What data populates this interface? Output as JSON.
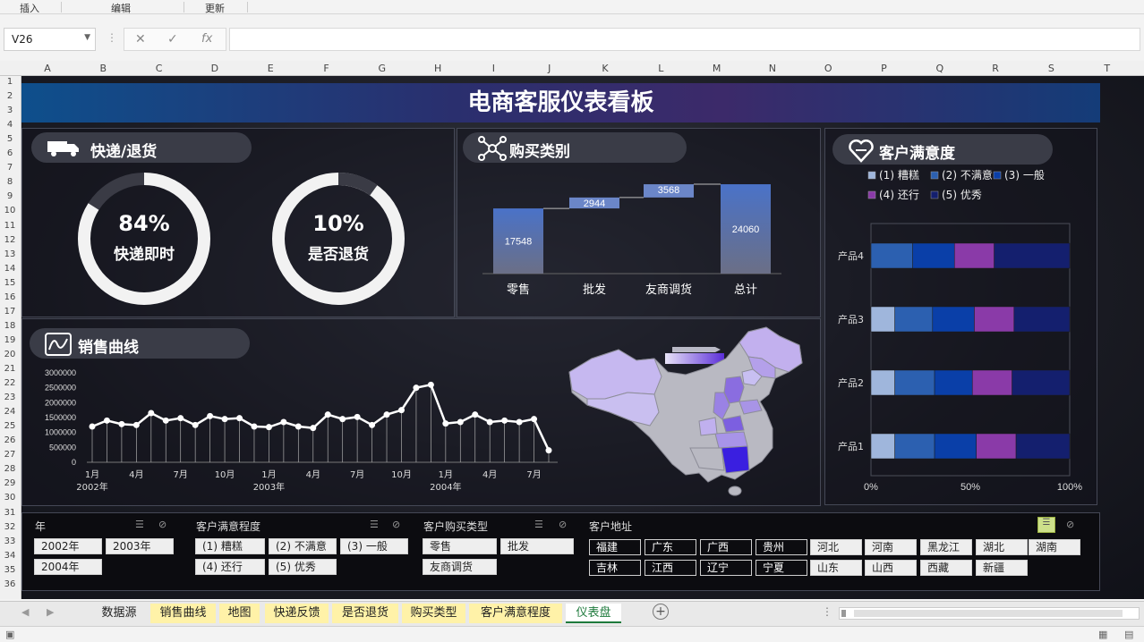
{
  "ribbon": {
    "insert": "插入",
    "edit": "编辑",
    "update": "更新"
  },
  "formula_bar": {
    "cell_ref": "V26",
    "cancel": "✕",
    "confirm": "✓",
    "fx": "fx",
    "value": ""
  },
  "columns": [
    "A",
    "B",
    "C",
    "D",
    "E",
    "F",
    "G",
    "H",
    "I",
    "J",
    "K",
    "L",
    "M",
    "N",
    "O",
    "P",
    "Q",
    "R",
    "S",
    "T"
  ],
  "rows": [
    "1",
    "2",
    "3",
    "4",
    "5",
    "6",
    "7",
    "8",
    "9",
    "10",
    "11",
    "12",
    "13",
    "14",
    "15",
    "16",
    "17",
    "18",
    "19",
    "20",
    "21",
    "22",
    "23",
    "24",
    "25",
    "26",
    "27",
    "28",
    "29",
    "30",
    "31",
    "32",
    "33",
    "34",
    "35",
    "36"
  ],
  "dashboard": {
    "title": "电商客服仪表看板",
    "express": {
      "title": "快递/退货",
      "ring1": {
        "value": "84%",
        "label": "快递即时",
        "fraction": 0.84
      },
      "ring2": {
        "value": "10%",
        "label": "是否退货",
        "fraction": 0.1
      }
    },
    "purchase": {
      "title": "购买类别"
    },
    "satisfaction": {
      "title": "客户满意度"
    },
    "sales": {
      "title": "销售曲线"
    },
    "map": {
      "title": ""
    }
  },
  "chart_data": [
    {
      "type": "bar",
      "subtype": "waterfall",
      "categories": [
        "零售",
        "批发",
        "友商调货",
        "总计"
      ],
      "values": [
        17548,
        2944,
        3568,
        24060
      ],
      "data_labels": [
        "17548",
        "2944",
        "3568",
        "24060"
      ],
      "ylim": [
        0,
        26000
      ],
      "colors": {
        "bar": "#3f6bc0",
        "floating": "#6b86c8"
      }
    },
    {
      "type": "bar",
      "subtype": "stacked_horizontal_100",
      "categories": [
        "产品1",
        "产品2",
        "产品3",
        "产品4"
      ],
      "series": [
        {
          "name": "(1) 糟糕",
          "values": [
            12,
            12,
            12,
            0
          ],
          "color": "#9fb6dc"
        },
        {
          "name": "(2) 不满意",
          "values": [
            20,
            20,
            19,
            21
          ],
          "color": "#2c60b0"
        },
        {
          "name": "(3) 一般",
          "values": [
            21,
            19,
            21,
            21
          ],
          "color": "#0a3fa8"
        },
        {
          "name": "(4) 还行",
          "values": [
            20,
            20,
            20,
            20
          ],
          "color": "#8a3aa8"
        },
        {
          "name": "(5) 优秀",
          "values": [
            27,
            29,
            28,
            38
          ],
          "color": "#141f6e"
        }
      ],
      "xticks": [
        "0%",
        "50%",
        "100%"
      ],
      "xlim": [
        0,
        100
      ],
      "legend": "top"
    },
    {
      "type": "line",
      "x": [
        "2002-01",
        "2002-02",
        "2002-03",
        "2002-04",
        "2002-05",
        "2002-06",
        "2002-07",
        "2002-08",
        "2002-09",
        "2002-10",
        "2002-11",
        "2002-12",
        "2003-01",
        "2003-02",
        "2003-03",
        "2003-04",
        "2003-05",
        "2003-06",
        "2003-07",
        "2003-08",
        "2003-09",
        "2003-10",
        "2003-11",
        "2003-12",
        "2004-01",
        "2004-02",
        "2004-03",
        "2004-04",
        "2004-05",
        "2004-06",
        "2004-07",
        "2004-08"
      ],
      "values": [
        1200000,
        1400000,
        1280000,
        1250000,
        1650000,
        1400000,
        1480000,
        1250000,
        1550000,
        1450000,
        1480000,
        1200000,
        1180000,
        1350000,
        1200000,
        1150000,
        1600000,
        1450000,
        1520000,
        1250000,
        1600000,
        1750000,
        2500000,
        2600000,
        1300000,
        1350000,
        1600000,
        1350000,
        1400000,
        1350000,
        1450000,
        400000
      ],
      "yticks": [
        "3000000",
        "2500000",
        "2000000",
        "1500000",
        "1000000",
        "500000",
        "0"
      ],
      "ylim": [
        0,
        3000000
      ],
      "xtick_labels": [
        "1月",
        "4月",
        "7月",
        "10月",
        "1月",
        "4月",
        "7月",
        "10月",
        "1月",
        "4月",
        "7月"
      ],
      "year_labels": [
        "2002年",
        "2003年",
        "2004年"
      ],
      "colors": {
        "line": "#ffffff"
      }
    }
  ],
  "slicers": {
    "year": {
      "title": "年",
      "items": [
        "2002年",
        "2003年",
        "2004年"
      ]
    },
    "satisfaction": {
      "title": "客户满意程度",
      "items": [
        "(1) 糟糕",
        "(2) 不满意",
        "(3) 一般",
        "(4) 还行",
        "(5) 优秀"
      ]
    },
    "purchase_type": {
      "title": "客户购买类型",
      "items": [
        "零售",
        "批发",
        "友商调货"
      ]
    },
    "address": {
      "title": "客户地址",
      "items": [
        "福建",
        "广东",
        "广西",
        "贵州",
        "河北",
        "河南",
        "黑龙江",
        "湖北",
        "湖南",
        "吉林",
        "江西",
        "辽宁",
        "宁夏",
        "山东",
        "山西",
        "西藏",
        "新疆"
      ]
    }
  },
  "tabs": [
    "数据源",
    "销售曲线",
    "地图",
    "快递反馈",
    "是否退货",
    "购买类型",
    "客户满意程度",
    "仪表盘"
  ],
  "active_tab": "仪表盘"
}
